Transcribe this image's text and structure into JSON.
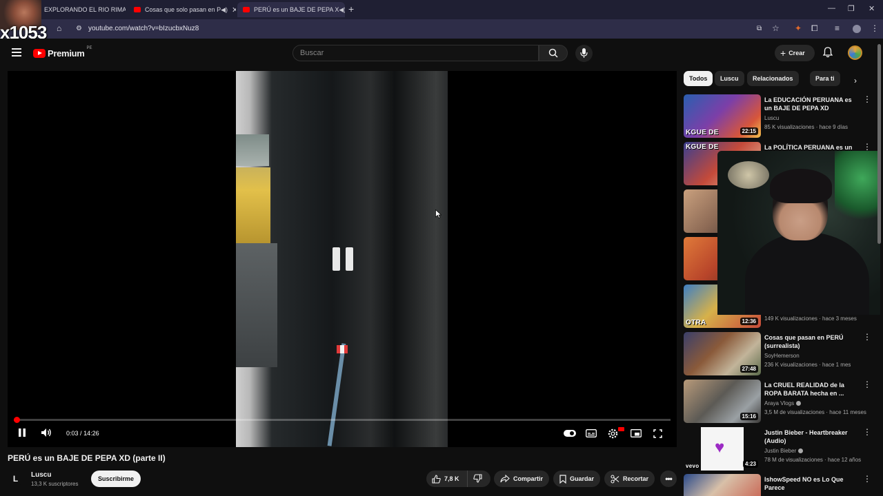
{
  "browser": {
    "tabs": [
      {
        "title": "EXPLORANDO EL RIO RIMA"
      },
      {
        "title": "Cosas que solo pasan en P"
      },
      {
        "title": "PERÚ es un BAJE DE PEPA X"
      }
    ],
    "url": "youtube.com/watch?v=bIzucbxNuz8"
  },
  "stream_overlay": {
    "number": "x1053"
  },
  "header": {
    "brand": "Premium",
    "country": "PE",
    "search_placeholder": "Buscar",
    "create_label": "Crear"
  },
  "player": {
    "time_current": "0:03",
    "time_separator": "/",
    "time_total": "14:26",
    "progress_fraction": 0.0035
  },
  "video": {
    "title": "PERÚ es un BAJE DE PEPA XD (parte II)",
    "channel": {
      "initial": "L",
      "name": "Luscu",
      "subscribers": "13,3 K suscriptores"
    },
    "subscribe_label": "Suscribirme",
    "likes": "7,8 K",
    "share_label": "Compartir",
    "save_label": "Guardar",
    "clip_label": "Recortar"
  },
  "sidebar": {
    "chips": [
      "Todos",
      "Luscu",
      "Relacionados",
      "Para ti"
    ],
    "recommendations": [
      {
        "title": "La EDUCACIÓN PERUANA es un BAJE DE PEPA XD",
        "channel": "Luscu",
        "meta": "85 K visualizaciones · hace 9 días",
        "duration": "22:15",
        "thumb_text": "KGUE DE"
      },
      {
        "title": "La POLÍTICA PERUANA es un",
        "channel": "",
        "meta": "",
        "duration": "",
        "thumb_text": "KGUE DE"
      },
      {
        "title": "",
        "channel": "",
        "meta": "",
        "duration": "",
        "thumb_text": ""
      },
      {
        "title": "",
        "channel": "",
        "meta": "",
        "duration": "",
        "thumb_text": ""
      },
      {
        "title": "",
        "channel": "",
        "meta": "149 K visualizaciones · hace 3 meses",
        "duration": "12:36",
        "thumb_text": "OTRA"
      },
      {
        "title": "Cosas que pasan en PERÚ (surrealista)",
        "channel": "SoyHemerson",
        "meta": "236 K visualizaciones · hace 1 mes",
        "duration": "27:48",
        "thumb_text": ""
      },
      {
        "title": "La CRUEL REALIDAD de la ROPA BARATA hecha en ...",
        "channel": "Araya Vlogs",
        "meta": "3,5 M de visualizaciones · hace 11 meses",
        "duration": "15:16",
        "thumb_text": ""
      },
      {
        "title": "Justin Bieber - Heartbreaker (Audio)",
        "channel": "Justin Bieber",
        "meta": "78 M de visualizaciones · hace 12 años",
        "duration": "4:23",
        "thumb_text": "vevo"
      },
      {
        "title": "IshowSpeed NO es Lo Que Parece",
        "channel": "",
        "meta": "",
        "duration": "",
        "thumb_text": ""
      }
    ]
  },
  "colors": {
    "accent": "#ff0000",
    "background": "#0f0f0f",
    "chip_bg": "#272727"
  }
}
